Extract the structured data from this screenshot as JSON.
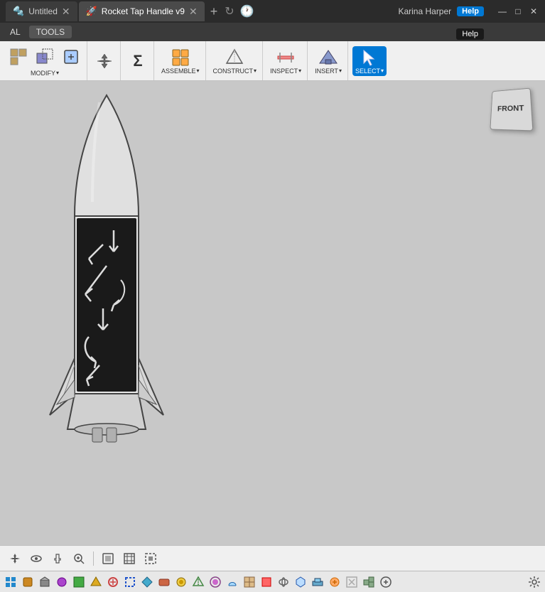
{
  "titlebar": {
    "tabs": [
      {
        "id": "tab-untitled",
        "label": "Untitled",
        "icon": "🔩",
        "active": false
      },
      {
        "id": "tab-rocket",
        "label": "Rocket Tap Handle v9",
        "icon": "🚀",
        "active": true
      }
    ],
    "add_tab_label": "+",
    "user": "Karina Harper",
    "help_label": "Help",
    "window_controls": {
      "minimize": "—",
      "maximize": "□",
      "close": "✕"
    }
  },
  "menubar": {
    "items": [
      {
        "id": "menu-al",
        "label": "AL"
      },
      {
        "id": "menu-tools",
        "label": "TOOLS"
      }
    ]
  },
  "toolbar": {
    "groups": [
      {
        "id": "group-modify",
        "tools": [
          {
            "id": "tool-modify1",
            "icon": "◱",
            "label": "MODIFY",
            "has_arrow": true
          },
          {
            "id": "tool-modify2",
            "icon": "◰",
            "label": ""
          },
          {
            "id": "tool-modify3",
            "icon": "⬚",
            "label": ""
          }
        ]
      },
      {
        "id": "group-move",
        "tools": [
          {
            "id": "tool-move",
            "icon": "✛",
            "label": ""
          }
        ]
      },
      {
        "id": "group-sigma",
        "tools": [
          {
            "id": "tool-sigma",
            "icon": "Σ",
            "label": ""
          }
        ]
      },
      {
        "id": "group-assemble",
        "tools": [
          {
            "id": "tool-assemble",
            "icon": "⚙",
            "label": "ASSEMBLE",
            "has_arrow": true
          }
        ]
      },
      {
        "id": "group-construct",
        "tools": [
          {
            "id": "tool-construct",
            "icon": "△",
            "label": "CONSTRUCT",
            "has_arrow": true
          }
        ]
      },
      {
        "id": "group-inspect",
        "tools": [
          {
            "id": "tool-inspect",
            "icon": "📏",
            "label": "INSPECT",
            "has_arrow": true
          }
        ]
      },
      {
        "id": "group-insert",
        "tools": [
          {
            "id": "tool-insert",
            "icon": "🏔",
            "label": "INSERT",
            "has_arrow": true
          }
        ]
      },
      {
        "id": "group-select",
        "tools": [
          {
            "id": "tool-select",
            "icon": "↖",
            "label": "SELECT",
            "has_arrow": true,
            "active": true
          }
        ]
      }
    ]
  },
  "canvas": {
    "background_color": "#c8c8c8",
    "view_cube_label": "FRONT"
  },
  "bottom_toolbar": {
    "buttons": [
      {
        "id": "btn-move-tool",
        "icon": "✛"
      },
      {
        "id": "btn-orbit",
        "icon": "✋"
      },
      {
        "id": "btn-pan",
        "icon": "🖐"
      },
      {
        "id": "btn-zoom",
        "icon": "🔍"
      },
      {
        "id": "btn-display",
        "icon": "▣"
      },
      {
        "id": "btn-grid",
        "icon": "⊞"
      },
      {
        "id": "btn-snap",
        "icon": "⊟"
      }
    ]
  },
  "component_bar": {
    "buttons": [
      "🔧",
      "📦",
      "🔲",
      "🔳",
      "⬛",
      "🔶",
      "🔷",
      "🔸",
      "🔹",
      "🟧",
      "🟦",
      "🟩",
      "🟪",
      "⬜",
      "🟫",
      "🟥",
      "⚪",
      "🔴",
      "🔵",
      "🟢",
      "🟡",
      "🟠",
      "⚙",
      "🔩"
    ]
  }
}
